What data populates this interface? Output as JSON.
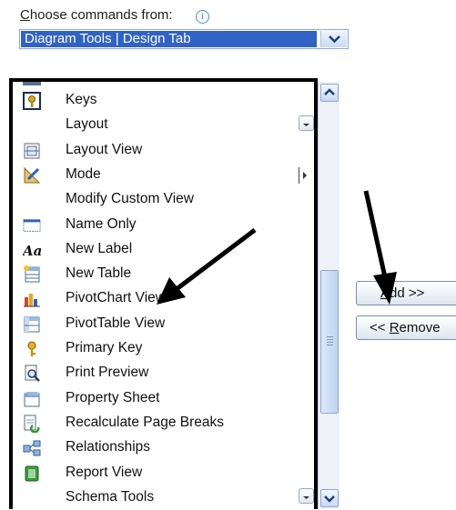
{
  "commands_label": {
    "accel": "C",
    "rest": "hoose commands from:"
  },
  "info_icon_glyph": "i",
  "combo": {
    "value": "Diagram Tools | Design Tab"
  },
  "list": {
    "items": [
      {
        "label": "Keys",
        "icon": "key-icon"
      },
      {
        "label": "Layout",
        "icon": "none",
        "submenu": "gallery"
      },
      {
        "label": "Layout View",
        "icon": "layout-view-icon"
      },
      {
        "label": "Mode",
        "icon": "ruler-pencil-icon",
        "submenu": "arrow"
      },
      {
        "label": "Modify Custom View",
        "icon": "none"
      },
      {
        "label": "Name Only",
        "icon": "name-only-icon"
      },
      {
        "label": "New Label",
        "icon": "new-label-icon",
        "glyph": "Aa"
      },
      {
        "label": "New Table",
        "icon": "new-table-icon"
      },
      {
        "label": "PivotChart View",
        "icon": "pivotchart-icon"
      },
      {
        "label": "PivotTable View",
        "icon": "pivottable-icon"
      },
      {
        "label": "Primary Key",
        "icon": "primary-key-icon"
      },
      {
        "label": "Print Preview",
        "icon": "print-preview-icon"
      },
      {
        "label": "Property Sheet",
        "icon": "property-sheet-icon"
      },
      {
        "label": "Recalculate Page Breaks",
        "icon": "recalculate-icon"
      },
      {
        "label": "Relationships",
        "icon": "relationships-icon"
      },
      {
        "label": "Report View",
        "icon": "report-view-icon"
      },
      {
        "label": "Schema Tools",
        "icon": "none",
        "submenu": "gallery"
      }
    ]
  },
  "buttons": {
    "add": {
      "accel": "A",
      "rest": "dd >>"
    },
    "remove": {
      "prefix": "<< ",
      "accel": "R",
      "rest": "emove"
    }
  },
  "colors": {
    "selection": "#3162c5",
    "annotation": "#000000"
  }
}
